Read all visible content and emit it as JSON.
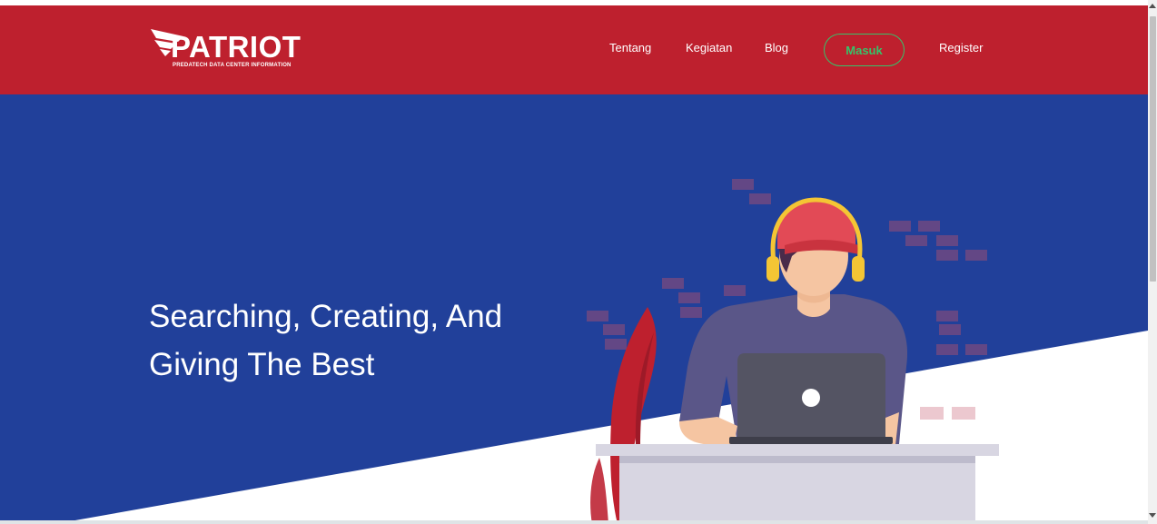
{
  "brand": {
    "name": "PATRIOT",
    "tagline": "PREDATECH DATA CENTER INFORMATION"
  },
  "nav": {
    "items": [
      {
        "label": "Tentang"
      },
      {
        "label": "Kegiatan"
      },
      {
        "label": "Blog"
      }
    ],
    "login_label": "Masuk",
    "register_label": "Register"
  },
  "hero": {
    "title_line1": "Searching, Creating, And",
    "title_line2": "Giving The Best"
  },
  "colors": {
    "navbar": "#be202e",
    "hero_blue": "#21409a",
    "login_green": "#35c46a"
  }
}
